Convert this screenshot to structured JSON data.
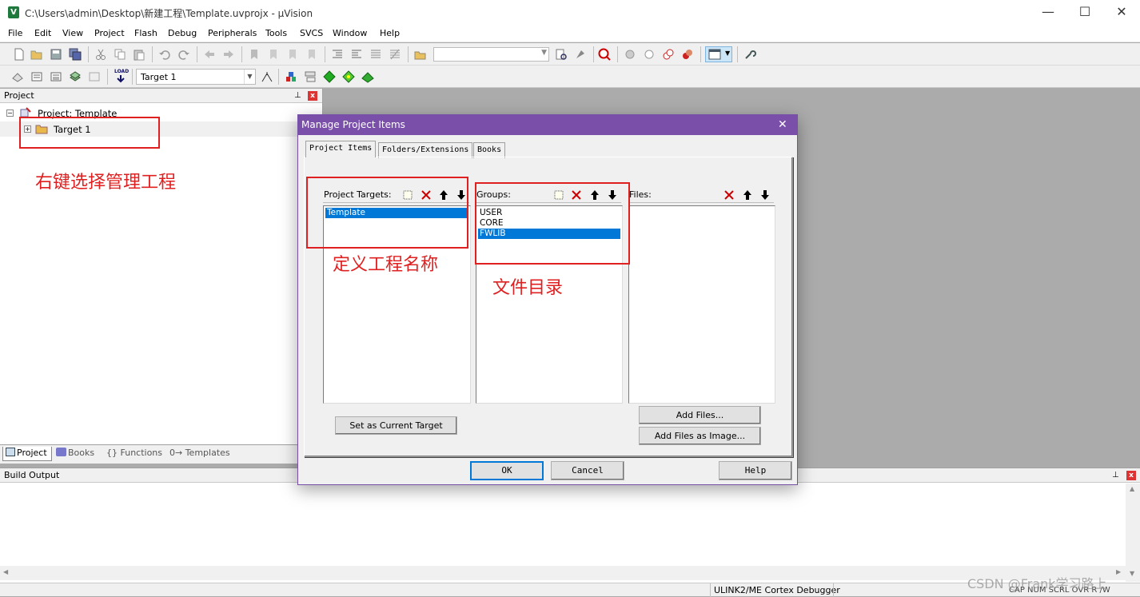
{
  "window": {
    "title": "C:\\Users\\admin\\Desktop\\新建工程\\Template.uvprojx - µVision",
    "app_icon_letter": "V",
    "minimize": "—",
    "maximize": "☐",
    "close": "✕"
  },
  "menu": [
    "File",
    "Edit",
    "View",
    "Project",
    "Flash",
    "Debug",
    "Peripherals",
    "Tools",
    "SVCS",
    "Window",
    "Help"
  ],
  "toolbar2": {
    "load_label": "LOAD",
    "target_select": "Target 1"
  },
  "project_panel": {
    "header": "Project",
    "tree_root": "Project: Template",
    "tree_child": "Target 1",
    "tabs": [
      "Project",
      "Books",
      "{} Functions",
      "0→ Templates"
    ],
    "pin_icon": "ㅁ",
    "close_icon": "x"
  },
  "annotations": {
    "right_click": "右键选择管理工程",
    "define_name": "定义工程名称",
    "file_dir": "文件目录"
  },
  "build_output": {
    "header": "Build Output"
  },
  "status_bar": {
    "debugger": "ULINK2/ME Cortex Debugger",
    "indicators": "CAP  NUM  SCRL  OVR  R /W",
    "watermark": "CSDN @Frank学习路上"
  },
  "dialog": {
    "title": "Manage Project Items",
    "close": "✕",
    "tabs": [
      "Project Items",
      "Folders/Extensions",
      "Books"
    ],
    "targets": {
      "label": "Project Targets:",
      "items": [
        "Template"
      ],
      "selected": 0
    },
    "groups": {
      "label": "Groups:",
      "items": [
        "USER",
        "CORE",
        "FWLIB"
      ],
      "selected": 2
    },
    "files": {
      "label": "Files:",
      "items": []
    },
    "buttons": {
      "set_current": "Set as Current Target",
      "add_files": "Add Files...",
      "add_image": "Add Files as Image...",
      "ok": "OK",
      "cancel": "Cancel",
      "help": "Help"
    }
  },
  "colors": {
    "dialog_title": "#7a4fa9",
    "selection": "#0078d7",
    "annotation": "#e02020"
  }
}
